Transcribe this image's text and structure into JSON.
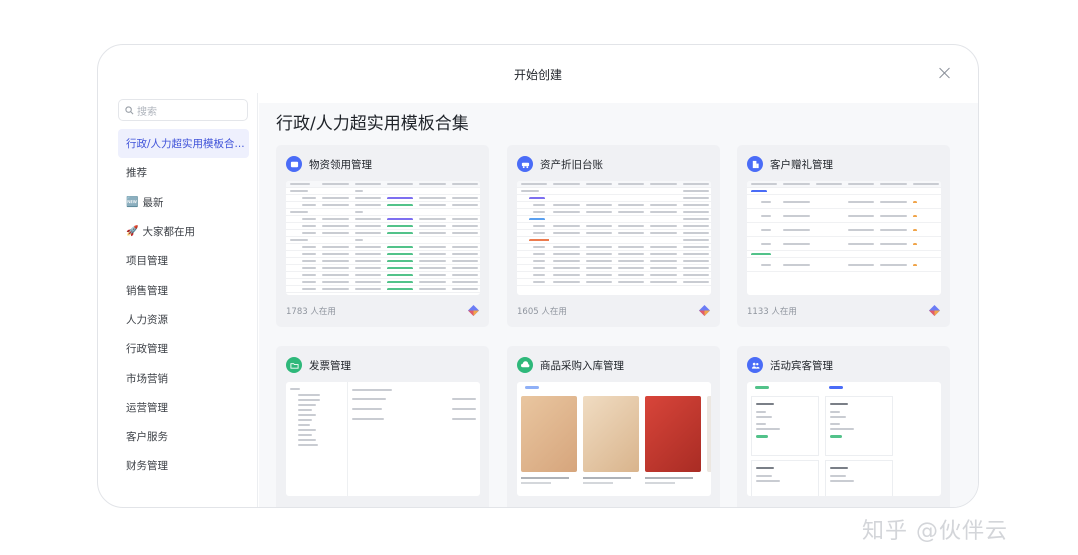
{
  "dialog": {
    "title": "开始创建",
    "close_label": "×"
  },
  "search": {
    "placeholder": "搜索"
  },
  "sidebar": {
    "items": [
      {
        "label": "行政/人力超实用模板合...",
        "icon": ""
      },
      {
        "label": "推荐",
        "icon": ""
      },
      {
        "label": "最新",
        "icon": "new-icon"
      },
      {
        "label": "大家都在用",
        "icon": "rocket-icon"
      },
      {
        "label": "项目管理",
        "icon": ""
      },
      {
        "label": "销售管理",
        "icon": ""
      },
      {
        "label": "人力资源",
        "icon": ""
      },
      {
        "label": "行政管理",
        "icon": ""
      },
      {
        "label": "市场营销",
        "icon": ""
      },
      {
        "label": "运营管理",
        "icon": ""
      },
      {
        "label": "客户服务",
        "icon": ""
      },
      {
        "label": "财务管理",
        "icon": ""
      }
    ]
  },
  "main": {
    "heading": "行政/人力超实用模板合集",
    "cards": [
      {
        "title": "物资领用管理",
        "usage": "1783 人在用",
        "icon": "box-icon",
        "color": "#4a6cf7"
      },
      {
        "title": "资产折旧台账",
        "usage": "1605 人在用",
        "icon": "car-icon",
        "color": "#4a6cf7"
      },
      {
        "title": "客户赠礼管理",
        "usage": "1133 人在用",
        "icon": "building-icon",
        "color": "#4a6cf7"
      },
      {
        "title": "发票管理",
        "usage": "",
        "icon": "folder-icon",
        "color": "#2eb87a"
      },
      {
        "title": "商品采购入库管理",
        "usage": "",
        "icon": "cloud-upload-icon",
        "color": "#2eb87a"
      },
      {
        "title": "活动宾客管理",
        "usage": "",
        "icon": "people-icon",
        "color": "#4a6cf7"
      }
    ]
  },
  "watermark": "知乎 @伙伴云",
  "colors": {
    "accent": "#3f52d9",
    "active_bg": "#eef0fd",
    "blue_badge": "#4a6cf7",
    "green_badge": "#2eb87a"
  }
}
